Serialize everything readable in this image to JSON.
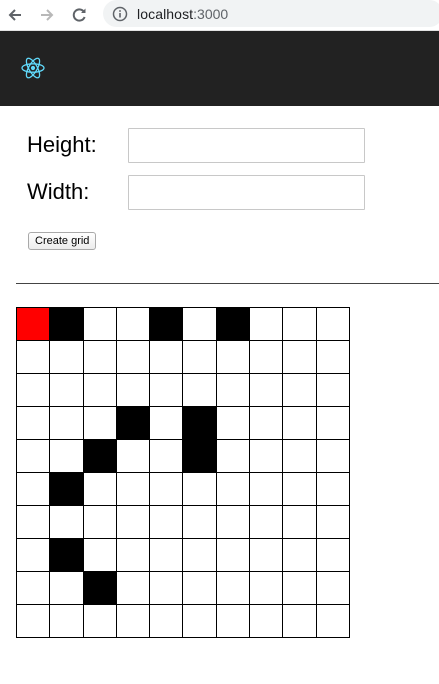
{
  "browser": {
    "url_host": "localhost",
    "url_port": ":3000"
  },
  "form": {
    "height_label": "Height:",
    "height_value": "",
    "width_label": "Width:",
    "width_value": "",
    "create_button_label": "Create grid"
  },
  "grid": {
    "rows": 10,
    "cols": 10,
    "cells": [
      [
        "start",
        "wall",
        "empty",
        "empty",
        "wall",
        "empty",
        "wall",
        "empty",
        "empty",
        "empty"
      ],
      [
        "empty",
        "empty",
        "empty",
        "empty",
        "empty",
        "empty",
        "empty",
        "empty",
        "empty",
        "empty"
      ],
      [
        "empty",
        "empty",
        "empty",
        "empty",
        "empty",
        "empty",
        "empty",
        "empty",
        "empty",
        "empty"
      ],
      [
        "empty",
        "empty",
        "empty",
        "wall",
        "empty",
        "wall",
        "empty",
        "empty",
        "empty",
        "empty"
      ],
      [
        "empty",
        "empty",
        "wall",
        "empty",
        "empty",
        "wall",
        "empty",
        "empty",
        "empty",
        "empty"
      ],
      [
        "empty",
        "wall",
        "empty",
        "empty",
        "empty",
        "empty",
        "empty",
        "empty",
        "empty",
        "empty"
      ],
      [
        "empty",
        "empty",
        "empty",
        "empty",
        "empty",
        "empty",
        "empty",
        "empty",
        "empty",
        "empty"
      ],
      [
        "empty",
        "wall",
        "empty",
        "empty",
        "empty",
        "empty",
        "empty",
        "empty",
        "empty",
        "empty"
      ],
      [
        "empty",
        "empty",
        "wall",
        "empty",
        "empty",
        "empty",
        "empty",
        "empty",
        "empty",
        "empty"
      ],
      [
        "empty",
        "empty",
        "empty",
        "empty",
        "empty",
        "empty",
        "empty",
        "empty",
        "empty",
        "empty"
      ]
    ],
    "colors": {
      "start": "#ff0000",
      "wall": "#000000",
      "empty": "#ffffff"
    }
  },
  "theme": {
    "header_bg": "#222222",
    "react_logo": "#61dafb"
  }
}
